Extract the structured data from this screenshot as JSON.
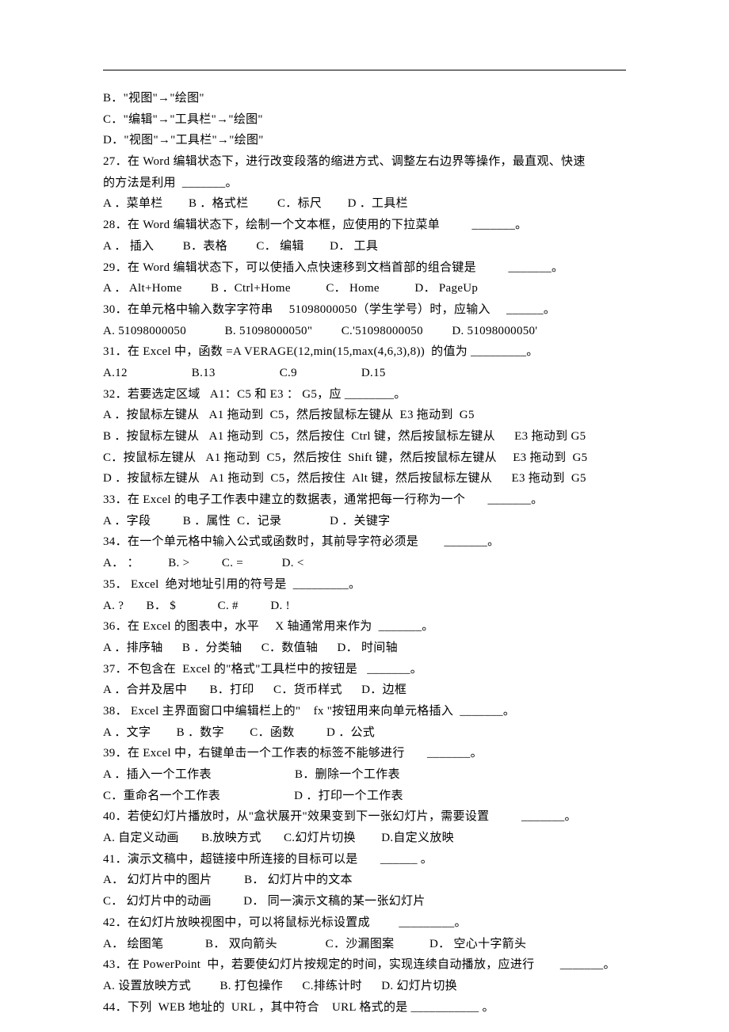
{
  "lines": [
    "B．\"视图\"→\"绘图\"",
    "C．\"编辑\"→\"工具栏\"→\"绘图\"",
    "D．\"视图\"→\"工具栏\"→\"绘图\"",
    "27．在 Word 编辑状态下，进行改变段落的缩进方式、调整左右边界等操作，最直观、快速",
    "的方法是利用  _______。",
    "A ．菜单栏        B ．格式栏         C．标尺        D ．工具栏",
    "28．在 Word 编辑状态下，绘制一个文本框，应使用的下拉菜单          _______。",
    "A ． 插入         B．表格         C． 编辑        D． 工具",
    "29．在 Word 编辑状态下，可以使插入点快速移到文档首部的组合键是          _______。",
    "A ． Alt+Home         B ．Ctrl+Home           C． Home           D． PageUp",
    "30．在单元格中输入数字字符串     51098000050（学生学号）时，应输入     ______。",
    "A. 51098000050            B. 51098000050\"         C.'51098000050         D. 51098000050'",
    "31．在 Excel 中，函数 =A VERAGE(12,min(15,max(4,6,3),8))  的值为 _________。",
    "A.12                    B.13                    C.9                    D.15",
    "32．若要选定区域   A1：C5 和 E3 ： G5，应 ________。",
    "A ．按鼠标左键从   A1 拖动到  C5，然后按鼠标左键从  E3 拖动到  G5",
    "B ．按鼠标左键从   A1 拖动到  C5，然后按住  Ctrl 键，然后按鼠标左键从      E3 拖动到 G5",
    "C．按鼠标左键从   A1 拖动到  C5，然后按住  Shift 键，然后按鼠标左键从     E3 拖动到  G5",
    "D ．按鼠标左键从   A1 拖动到  C5，然后按住  Alt 键，然后按鼠标左键从      E3 拖动到  G5",
    "33．在 Excel 的电子工作表中建立的数据表，通常把每一行称为一个       _______。",
    "A ．字段          B ．属性  C．记录               D ．关键字",
    "34．在一个单元格中输入公式或函数时，其前导字符必须是        _______。",
    "A． ：         B. >          C. =            D. <",
    "35． Excel  绝对地址引用的符号是  _________。",
    "A. ?       B． $             C. #          D. !",
    "36．在 Excel 的图表中，水平     X 轴通常用来作为  _______。",
    "A ．排序轴      B ．分类轴      C．数值轴      D． 时间轴",
    "37．不包含在  Excel 的\"格式\"工具栏中的按钮是   _______。",
    "A ．合并及居中       B．打印      C．货币样式      D．边框",
    "38． Excel 主界面窗口中编辑栏上的\"    fx \"按钮用来向单元格插入  _______。",
    "A ．文字        B ．数字        C．函数          D ．公式",
    "39．在 Excel 中，右键单击一个工作表的标签不能够进行       _______。",
    "A ．插入一个工作表                          B．删除一个工作表",
    "C．重命名一个工作表                       D ．打印一个工作表",
    "40．若使幻灯片播放时，从\"盒状展开\"效果变到下一张幻灯片，需要设置          _______。",
    "A. 自定义动画       B.放映方式       C.幻灯片切换        D.自定义放映",
    "41．演示文稿中，超链接中所连接的目标可以是       ______ 。",
    "A． 幻灯片中的图片          B． 幻灯片中的文本",
    "C． 幻灯片中的动画          D． 同一演示文稿的某一张幻灯片",
    "42．在幻灯片放映视图中，可以将鼠标光标设置成         _________。",
    "A． 绘图笔             B． 双向箭头               C．沙漏图案           D． 空心十字箭头",
    "43．在 PowerPoint  中，若要使幻灯片按规定的时间，实现连续自动播放，应进行        _______。",
    "A. 设置放映方式         B. 打包操作      C.排练计时      D. 幻灯片切换",
    "44．下列  WEB 地址的  URL ，其中符合    URL 格式的是 ___________ 。"
  ]
}
